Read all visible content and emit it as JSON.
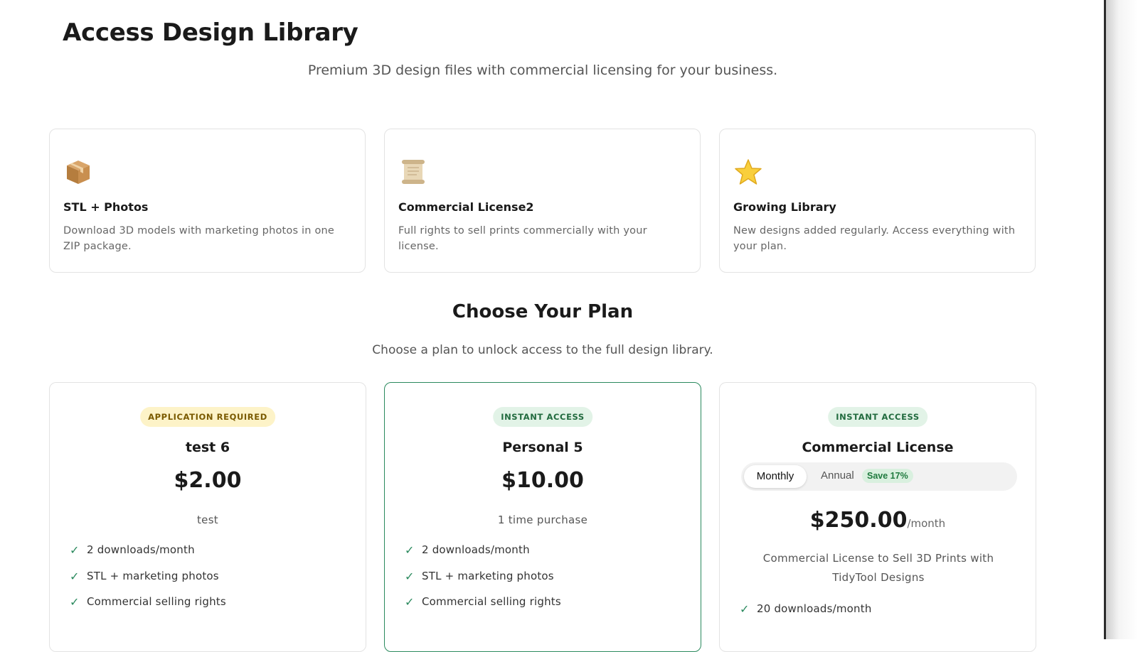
{
  "header": {
    "title": "Access Design Library",
    "subtitle": "Premium 3D design files with commercial licensing for your business."
  },
  "features": [
    {
      "icon": "package-icon",
      "title": "STL + Photos",
      "desc": "Download 3D models with marketing photos in one ZIP package."
    },
    {
      "icon": "scroll-icon",
      "title": "Commercial License2",
      "desc": "Full rights to sell prints commercially with your license."
    },
    {
      "icon": "star-icon",
      "title": "Growing Library",
      "desc": "New designs added regularly. Access everything with your plan."
    }
  ],
  "plans_section": {
    "title": "Choose Your Plan",
    "subtitle": "Choose a plan to unlock access to the full design library."
  },
  "plans": [
    {
      "badge": "APPLICATION REQUIRED",
      "name": "test 6",
      "price": "$2.00",
      "note": "test",
      "features": [
        "2 downloads/month",
        "STL + marketing photos",
        "Commercial selling rights"
      ]
    },
    {
      "badge": "INSTANT ACCESS",
      "name": "Personal 5",
      "price": "$10.00",
      "note": "1 time purchase",
      "features": [
        "2 downloads/month",
        "STL + marketing photos",
        "Commercial selling rights"
      ]
    },
    {
      "badge": "INSTANT ACCESS",
      "name": "Commercial License",
      "billing": {
        "monthly": "Monthly",
        "annual": "Annual",
        "save": "Save 17%",
        "selected": "Monthly"
      },
      "price": "$250.00",
      "period": "/month",
      "note": "Commercial License to Sell 3D Prints with TidyTool Designs",
      "features": [
        "20 downloads/month"
      ]
    }
  ],
  "colors": {
    "accent": "#2b8a5e",
    "badge_yellow_bg": "#fdf3c8",
    "badge_green_bg": "#e2f3e7"
  },
  "check_glyph": "✓"
}
